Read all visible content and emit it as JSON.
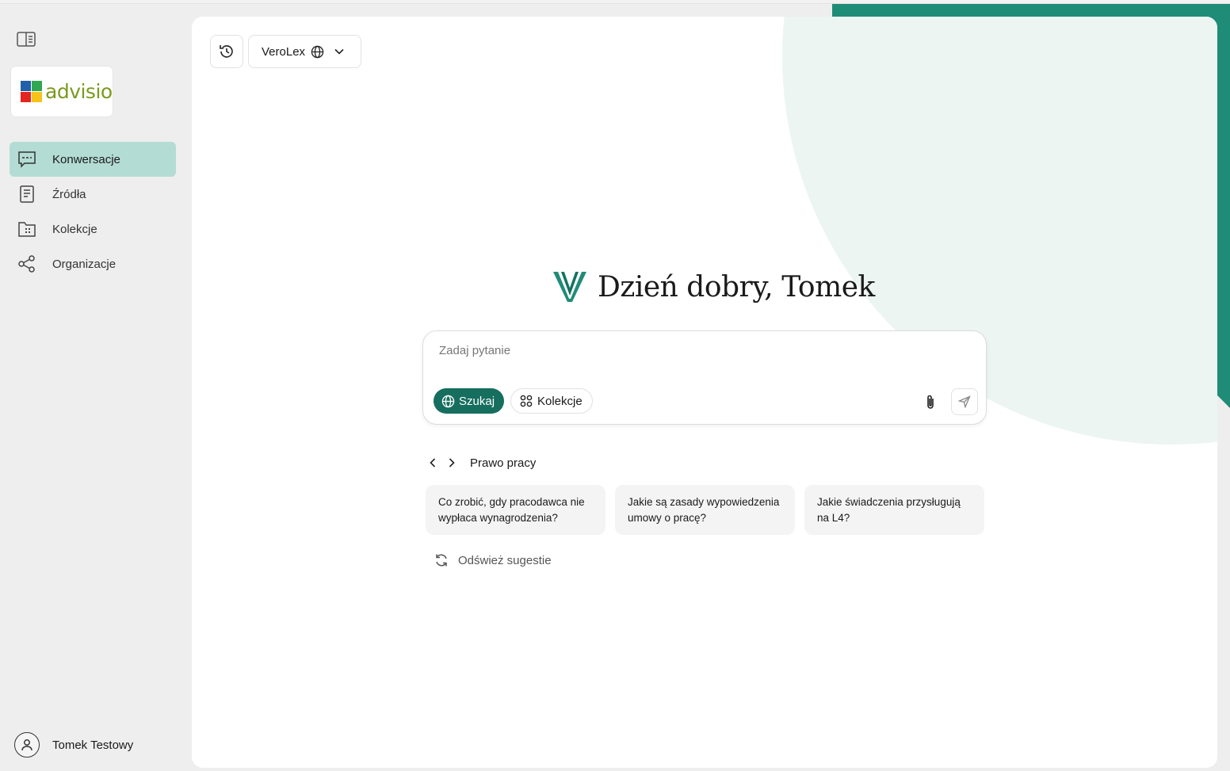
{
  "sidebar": {
    "logo_text": "advisio",
    "nav": [
      {
        "label": "Konwersacje",
        "icon": "chat-icon",
        "active": true
      },
      {
        "label": "Źródła",
        "icon": "document-icon",
        "active": false
      },
      {
        "label": "Kolekcje",
        "icon": "folder-icon",
        "active": false
      },
      {
        "label": "Organizacje",
        "icon": "share-icon",
        "active": false
      }
    ],
    "user": {
      "name": "Tomek Testowy"
    }
  },
  "header": {
    "model": "VeroLex"
  },
  "greeting": "Dzień dobry, Tomek",
  "chat": {
    "placeholder": "Zadaj pytanie",
    "search_label": "Szukaj",
    "collections_label": "Kolekcje"
  },
  "suggestions": {
    "category": "Prawo pracy",
    "items": [
      "Co zrobić, gdy pracodawca nie wypłaca wynagrodzenia?",
      "Jakie są zasady wypowiedzenia umowy o pracę?",
      "Jakie świadczenia przysługują na L4?"
    ],
    "refresh_label": "Odśwież sugestie"
  },
  "colors": {
    "accent": "#166e5e",
    "active_nav": "#b3dcd4",
    "brand_green": "#1f8c77"
  }
}
